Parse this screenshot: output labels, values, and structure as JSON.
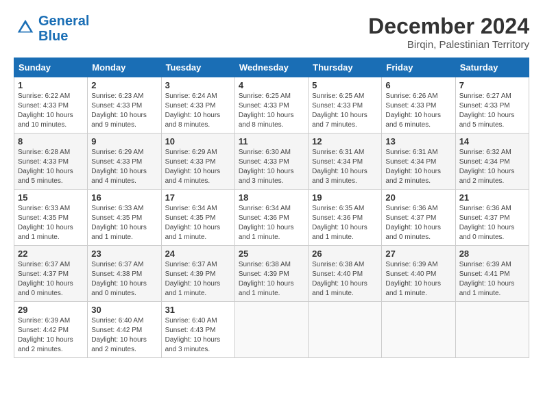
{
  "header": {
    "logo_line1": "General",
    "logo_line2": "Blue",
    "month": "December 2024",
    "location": "Birqin, Palestinian Territory"
  },
  "weekdays": [
    "Sunday",
    "Monday",
    "Tuesday",
    "Wednesday",
    "Thursday",
    "Friday",
    "Saturday"
  ],
  "weeks": [
    [
      {
        "day": "1",
        "info": "Sunrise: 6:22 AM\nSunset: 4:33 PM\nDaylight: 10 hours\nand 10 minutes."
      },
      {
        "day": "2",
        "info": "Sunrise: 6:23 AM\nSunset: 4:33 PM\nDaylight: 10 hours\nand 9 minutes."
      },
      {
        "day": "3",
        "info": "Sunrise: 6:24 AM\nSunset: 4:33 PM\nDaylight: 10 hours\nand 8 minutes."
      },
      {
        "day": "4",
        "info": "Sunrise: 6:25 AM\nSunset: 4:33 PM\nDaylight: 10 hours\nand 8 minutes."
      },
      {
        "day": "5",
        "info": "Sunrise: 6:25 AM\nSunset: 4:33 PM\nDaylight: 10 hours\nand 7 minutes."
      },
      {
        "day": "6",
        "info": "Sunrise: 6:26 AM\nSunset: 4:33 PM\nDaylight: 10 hours\nand 6 minutes."
      },
      {
        "day": "7",
        "info": "Sunrise: 6:27 AM\nSunset: 4:33 PM\nDaylight: 10 hours\nand 5 minutes."
      }
    ],
    [
      {
        "day": "8",
        "info": "Sunrise: 6:28 AM\nSunset: 4:33 PM\nDaylight: 10 hours\nand 5 minutes."
      },
      {
        "day": "9",
        "info": "Sunrise: 6:29 AM\nSunset: 4:33 PM\nDaylight: 10 hours\nand 4 minutes."
      },
      {
        "day": "10",
        "info": "Sunrise: 6:29 AM\nSunset: 4:33 PM\nDaylight: 10 hours\nand 4 minutes."
      },
      {
        "day": "11",
        "info": "Sunrise: 6:30 AM\nSunset: 4:33 PM\nDaylight: 10 hours\nand 3 minutes."
      },
      {
        "day": "12",
        "info": "Sunrise: 6:31 AM\nSunset: 4:34 PM\nDaylight: 10 hours\nand 3 minutes."
      },
      {
        "day": "13",
        "info": "Sunrise: 6:31 AM\nSunset: 4:34 PM\nDaylight: 10 hours\nand 2 minutes."
      },
      {
        "day": "14",
        "info": "Sunrise: 6:32 AM\nSunset: 4:34 PM\nDaylight: 10 hours\nand 2 minutes."
      }
    ],
    [
      {
        "day": "15",
        "info": "Sunrise: 6:33 AM\nSunset: 4:35 PM\nDaylight: 10 hours\nand 1 minute."
      },
      {
        "day": "16",
        "info": "Sunrise: 6:33 AM\nSunset: 4:35 PM\nDaylight: 10 hours\nand 1 minute."
      },
      {
        "day": "17",
        "info": "Sunrise: 6:34 AM\nSunset: 4:35 PM\nDaylight: 10 hours\nand 1 minute."
      },
      {
        "day": "18",
        "info": "Sunrise: 6:34 AM\nSunset: 4:36 PM\nDaylight: 10 hours\nand 1 minute."
      },
      {
        "day": "19",
        "info": "Sunrise: 6:35 AM\nSunset: 4:36 PM\nDaylight: 10 hours\nand 1 minute."
      },
      {
        "day": "20",
        "info": "Sunrise: 6:36 AM\nSunset: 4:37 PM\nDaylight: 10 hours\nand 0 minutes."
      },
      {
        "day": "21",
        "info": "Sunrise: 6:36 AM\nSunset: 4:37 PM\nDaylight: 10 hours\nand 0 minutes."
      }
    ],
    [
      {
        "day": "22",
        "info": "Sunrise: 6:37 AM\nSunset: 4:37 PM\nDaylight: 10 hours\nand 0 minutes."
      },
      {
        "day": "23",
        "info": "Sunrise: 6:37 AM\nSunset: 4:38 PM\nDaylight: 10 hours\nand 0 minutes."
      },
      {
        "day": "24",
        "info": "Sunrise: 6:37 AM\nSunset: 4:39 PM\nDaylight: 10 hours\nand 1 minute."
      },
      {
        "day": "25",
        "info": "Sunrise: 6:38 AM\nSunset: 4:39 PM\nDaylight: 10 hours\nand 1 minute."
      },
      {
        "day": "26",
        "info": "Sunrise: 6:38 AM\nSunset: 4:40 PM\nDaylight: 10 hours\nand 1 minute."
      },
      {
        "day": "27",
        "info": "Sunrise: 6:39 AM\nSunset: 4:40 PM\nDaylight: 10 hours\nand 1 minute."
      },
      {
        "day": "28",
        "info": "Sunrise: 6:39 AM\nSunset: 4:41 PM\nDaylight: 10 hours\nand 1 minute."
      }
    ],
    [
      {
        "day": "29",
        "info": "Sunrise: 6:39 AM\nSunset: 4:42 PM\nDaylight: 10 hours\nand 2 minutes."
      },
      {
        "day": "30",
        "info": "Sunrise: 6:40 AM\nSunset: 4:42 PM\nDaylight: 10 hours\nand 2 minutes."
      },
      {
        "day": "31",
        "info": "Sunrise: 6:40 AM\nSunset: 4:43 PM\nDaylight: 10 hours\nand 3 minutes."
      },
      {
        "day": "",
        "info": ""
      },
      {
        "day": "",
        "info": ""
      },
      {
        "day": "",
        "info": ""
      },
      {
        "day": "",
        "info": ""
      }
    ]
  ]
}
